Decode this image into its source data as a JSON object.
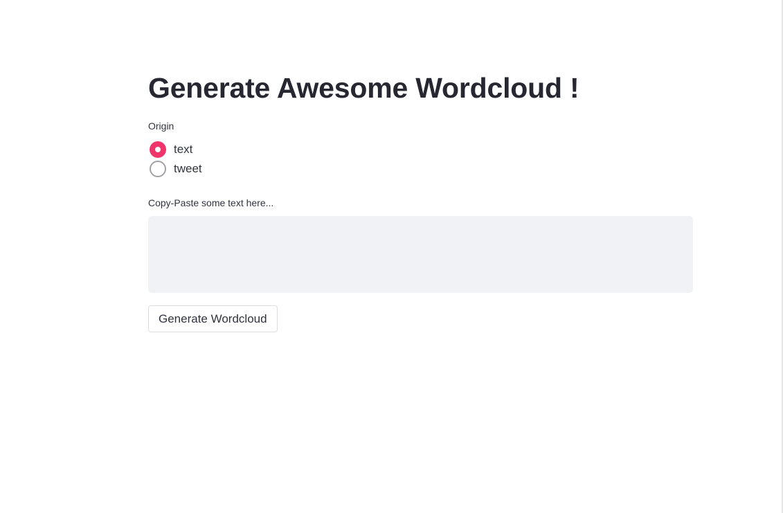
{
  "header": {
    "title": "Generate Awesome Wordcloud !"
  },
  "origin": {
    "label": "Origin",
    "options": [
      {
        "label": "text",
        "selected": true
      },
      {
        "label": "tweet",
        "selected": false
      }
    ]
  },
  "text_input": {
    "label": "Copy-Paste some text here...",
    "value": "",
    "placeholder": ""
  },
  "actions": {
    "generate_label": "Generate Wordcloud"
  },
  "colors": {
    "accent": "#f0356b",
    "input_background": "#f0f2f6",
    "text": "#262730"
  }
}
